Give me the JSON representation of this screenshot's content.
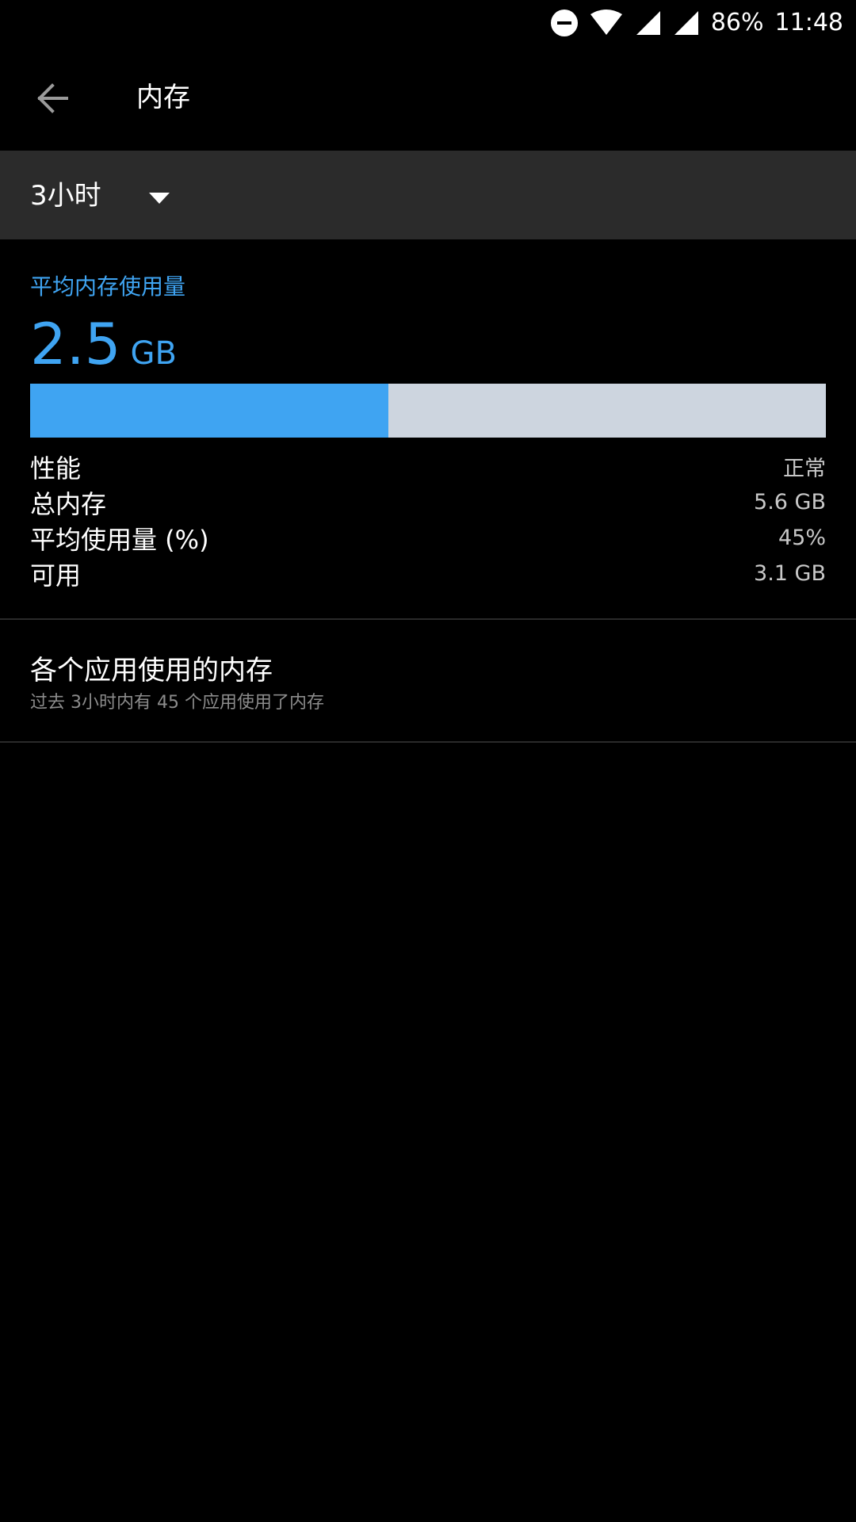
{
  "status_bar": {
    "battery": "86%",
    "time": "11:48",
    "icons": [
      "do-not-disturb-icon",
      "wifi-icon",
      "signal-icon",
      "signal-icon"
    ]
  },
  "toolbar": {
    "title": "内存",
    "back_icon": "arrow-left-icon"
  },
  "period_selector": {
    "selected": "3小时"
  },
  "summary": {
    "avg_label": "平均内存使用量",
    "avg_value": "2.5",
    "avg_unit": "GB",
    "usage_fraction": 0.45,
    "colors": {
      "used": "#3fa4f2",
      "free": "#cdd5df"
    }
  },
  "stats": [
    {
      "label": "性能",
      "value": "正常"
    },
    {
      "label": "总内存",
      "value": "5.6 GB"
    },
    {
      "label": "平均使用量 (%)",
      "value": "45%"
    },
    {
      "label": "可用",
      "value": "3.1 GB"
    }
  ],
  "apps_section": {
    "title": "各个应用使用的内存",
    "subtitle": "过去 3小时内有 45 个应用使用了内存"
  }
}
